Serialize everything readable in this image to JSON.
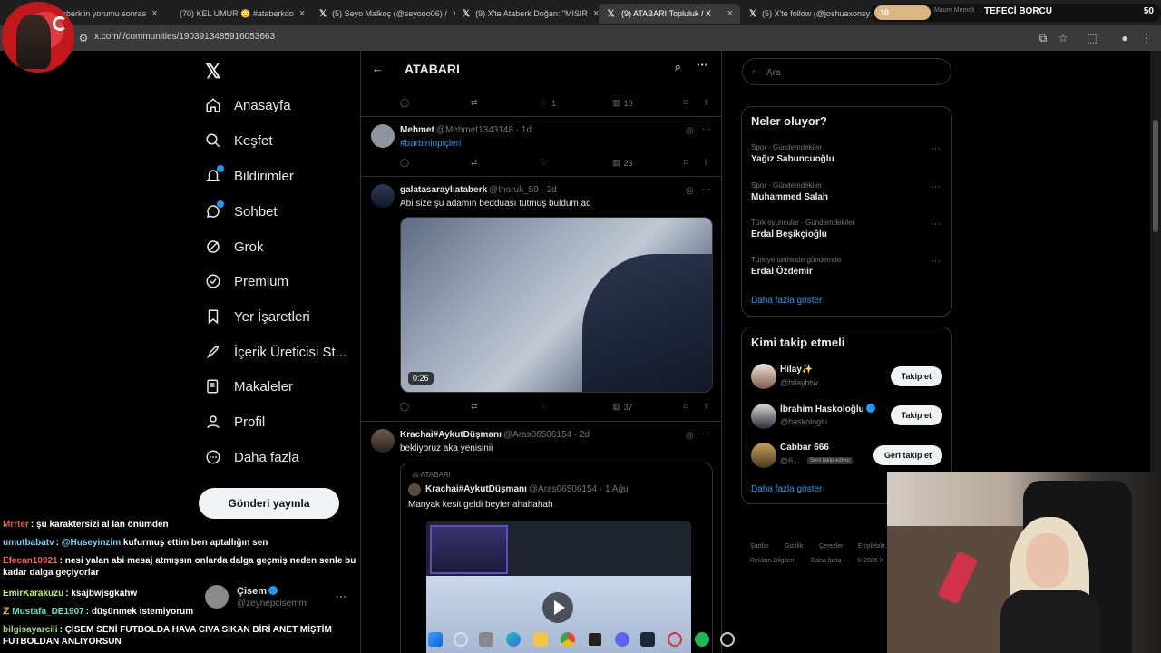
{
  "browser": {
    "tabs": [
      {
        "title": "aberk'in yorumu sonras",
        "icon": "tab-fav-icon",
        "active": false
      },
      {
        "title": "(70) KEL UMUR 😳 #ataberkdo",
        "icon": "youtube-icon",
        "active": false
      },
      {
        "title": "(5) Seyo Malkoç (@seyooo06) /",
        "icon": "x-icon",
        "active": false
      },
      {
        "title": "(9) X'te Ataberk Doğan: \"MISIR",
        "icon": "x-icon",
        "active": false
      },
      {
        "title": "(9) ATABARI Topluluk / X",
        "icon": "x-icon",
        "active": true
      },
      {
        "title": "(5) X'te follow (@joshuaxonsy:",
        "icon": "x-icon",
        "active": false
      }
    ],
    "url": "x.com/i/communities/1903913485916053663"
  },
  "overlay": {
    "level": "10",
    "name": "Mauro Memoli",
    "title": "TEFECİ BORCU",
    "value": "50"
  },
  "nav": {
    "home": "Anasayfa",
    "explore": "Keşfet",
    "notifications": "Bildirimler",
    "chat": "Sohbet",
    "grok": "Grok",
    "premium": "Premium",
    "bookmarks": "Yer İşaretleri",
    "creator": "İçerik Üreticisi St...",
    "articles": "Makaleler",
    "profile": "Profil",
    "more": "Daha fazla",
    "post": "Gönderi yayınla"
  },
  "account": {
    "name": "Çisem",
    "handle": "@zeynepcisemm"
  },
  "header": {
    "title": "ATABARI"
  },
  "tweets": {
    "t0": {
      "likes": "1",
      "views": "10"
    },
    "t1": {
      "name": "Mehmet",
      "handle": "@Mehmet1343148 · 1d",
      "text": "#barbininpiçleri",
      "views": "26"
    },
    "t2": {
      "name": "galatasaraylıataberk",
      "handle": "@thoruk_59 · 2d",
      "text": "Abi size şu adamın bedduası tutmuş buldum aq",
      "duration": "0:26",
      "views": "37"
    },
    "t3": {
      "name": "Krachai#AykutDüşmanı",
      "handle": "@Aras06506154 · 2d",
      "text": "bekliyoruz aka yenisinii",
      "quote": {
        "community": "ATABARI",
        "name": "Krachai#AykutDüşmanı",
        "handle": "@Aras06506154 · 1 Ağu",
        "text": "Manyak kesit geldi beyler ahahahah"
      }
    }
  },
  "search": {
    "placeholder": "Ara"
  },
  "trends": {
    "title": "Neler oluyor?",
    "items": [
      {
        "category": "Spor · Gündemdekiler",
        "name": "Yağız Sabuncuoğlu"
      },
      {
        "category": "Spor · Gündemdekiler",
        "name": "Muhammed Salah"
      },
      {
        "category": "Türk oyuncular · Gündemdekiler",
        "name": "Erdal Beşikçioğlu"
      },
      {
        "category": "Türkiye tarihinde gündemde",
        "name": "Erdal Özdemir"
      }
    ],
    "show_more": "Daha fazla göster"
  },
  "who_to_follow": {
    "title": "Kimi takip etmeli",
    "users": [
      {
        "name": "Hilay✨",
        "handle": "@hilaybtw",
        "button": "Takip et"
      },
      {
        "name": "İbrahim Haskoloğlu",
        "handle": "@haskologlu",
        "button": "Takip et"
      },
      {
        "name": "Cabbar 666",
        "handle": "@6...",
        "badge": "Seni takip ediyor",
        "button": "Geri takip et"
      }
    ],
    "show_more": "Daha fazla göster"
  },
  "footer": {
    "l1": "Şartlar",
    "l2": "Gizlilik",
    "l3": "Çerezler",
    "l4": "Erişilebilir...",
    "l5": "Reklam Bilgileri",
    "l6": "Daha fazla ···",
    "l7": "© 2026 X"
  },
  "chat": [
    {
      "user": "Mrrter",
      "color": "#d4643c",
      "text": "şu karaktersizi al lan önümden"
    },
    {
      "user": "umutbabatv",
      "color": "#6fd3ff",
      "mention": "@Huseyinzim",
      "text": "kufurmuş ettim ben aptallığın sen"
    },
    {
      "user": "Efecan10921",
      "color": "#ff5d5d",
      "text": "nesi yalan abi mesaj atmışsın onlarda dalga geçmiş neden senle bu kadar dalga geçiyorlar"
    },
    {
      "user": "EmirKarakuzu",
      "color": "#c6f25a",
      "text": "ksajbwjsgkahw"
    },
    {
      "user": "Mustafa_DE1907",
      "color": "#5ee6c4",
      "text": "düşünmek istemiyorum"
    },
    {
      "user": "bilgisayarcili",
      "color": "#9fe07b",
      "text": "ÇİSEM SENİ FUTBOLDA HAVA CIVA SIKAN BİRİ ANET MİŞTİM FUTBOLDAN ANLIYORSUN"
    }
  ],
  "colors": {
    "accent": "#1d9bf0",
    "background": "#000000",
    "border": "#2f3336"
  }
}
